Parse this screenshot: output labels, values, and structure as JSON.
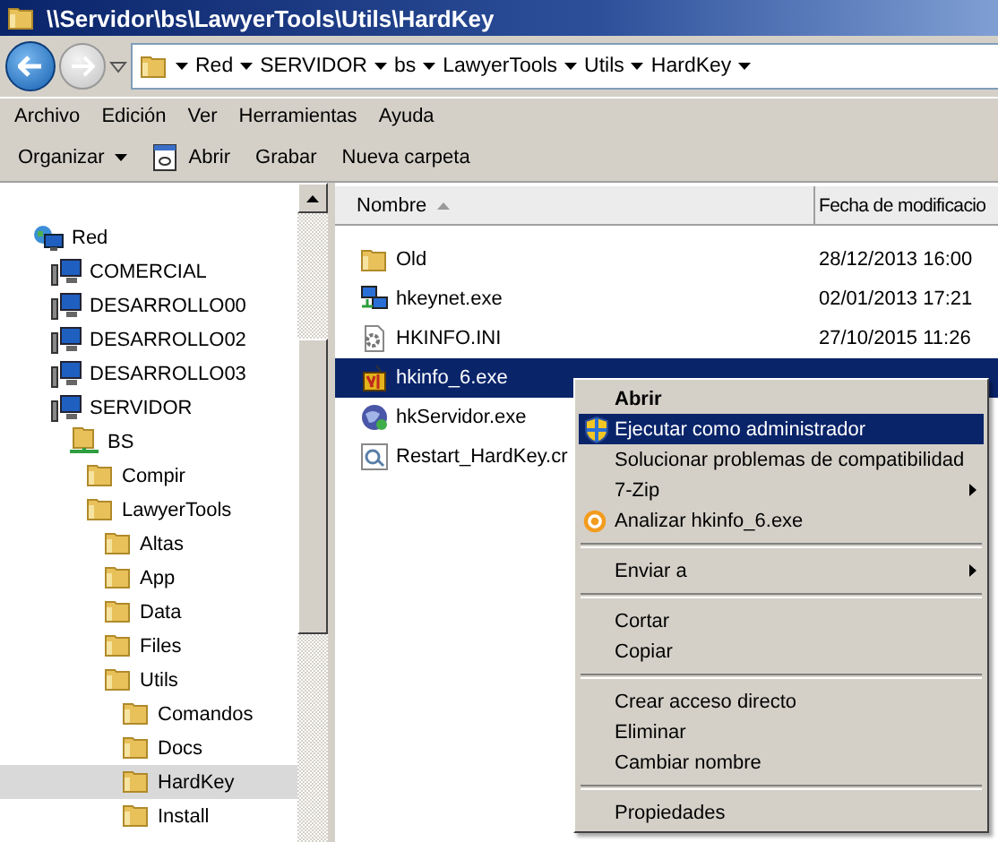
{
  "window": {
    "title": "\\\\Servidor\\bs\\LawyerTools\\Utils\\HardKey"
  },
  "breadcrumb": [
    "Red",
    "SERVIDOR",
    "bs",
    "LawyerTools",
    "Utils",
    "HardKey"
  ],
  "menu_bar": [
    "Archivo",
    "Edición",
    "Ver",
    "Herramientas",
    "Ayuda"
  ],
  "toolbar": [
    {
      "label": "Organizar",
      "kind": "dropdown"
    },
    {
      "label": "Abrir",
      "kind": "open"
    },
    {
      "label": "Grabar",
      "kind": "plain"
    },
    {
      "label": "Nueva carpeta",
      "kind": "plain"
    }
  ],
  "tree": [
    {
      "label": "Red",
      "kind": "network",
      "selected": false,
      "children": [
        {
          "label": "COMERCIAL",
          "kind": "computer",
          "selected": false
        },
        {
          "label": "DESARROLLO00",
          "kind": "computer",
          "selected": false
        },
        {
          "label": "DESARROLLO02",
          "kind": "computer",
          "selected": false
        },
        {
          "label": "DESARROLLO03",
          "kind": "computer",
          "selected": false
        },
        {
          "label": "SERVIDOR",
          "kind": "computer",
          "selected": false,
          "children": [
            {
              "label": "BS",
              "kind": "share",
              "selected": false,
              "children": [
                {
                  "label": "Compir",
                  "kind": "folder",
                  "selected": false
                },
                {
                  "label": "LawyerTools",
                  "kind": "folder",
                  "selected": false,
                  "children": [
                    {
                      "label": "Altas",
                      "kind": "folder",
                      "selected": false
                    },
                    {
                      "label": "App",
                      "kind": "folder",
                      "selected": false
                    },
                    {
                      "label": "Data",
                      "kind": "folder",
                      "selected": false
                    },
                    {
                      "label": "Files",
                      "kind": "folder",
                      "selected": false
                    },
                    {
                      "label": "Utils",
                      "kind": "folder",
                      "selected": false,
                      "children": [
                        {
                          "label": "Comandos",
                          "kind": "folder",
                          "selected": false
                        },
                        {
                          "label": "Docs",
                          "kind": "folder",
                          "selected": false
                        },
                        {
                          "label": "HardKey",
                          "kind": "folder",
                          "selected": true
                        },
                        {
                          "label": "Install",
                          "kind": "folder",
                          "selected": false
                        }
                      ]
                    }
                  ]
                }
              ]
            }
          ]
        }
      ]
    }
  ],
  "columns": [
    {
      "label": "Nombre",
      "kind": "sorted"
    },
    {
      "label": "Fecha de modificacio",
      "kind": "plain"
    }
  ],
  "files": [
    {
      "name": "Old",
      "date": "28/12/2013 16:00",
      "kind": "folder",
      "selected": false
    },
    {
      "name": "hkeynet.exe",
      "date": "02/01/2013 17:21",
      "kind": "network-app",
      "selected": false
    },
    {
      "name": "HKINFO.INI",
      "date": "27/10/2015 11:26",
      "kind": "settings-file",
      "selected": false
    },
    {
      "name": "hkinfo_6.exe",
      "kind": "program",
      "selected": true
    },
    {
      "name": "hkServidor.exe",
      "kind": "globe",
      "selected": false
    },
    {
      "name": "Restart_HardKey.cr",
      "kind": "script",
      "selected": false
    }
  ],
  "context_menu": [
    {
      "kind": "default",
      "label": "Abrir",
      "selected": false
    },
    {
      "kind": "admin",
      "label": "Ejecutar como administrador",
      "selected": true
    },
    {
      "kind": "plain",
      "label": "Solucionar problemas de compatibilidad",
      "selected": false
    },
    {
      "kind": "submenu",
      "label": "7-Zip",
      "selected": false
    },
    {
      "kind": "analyze",
      "label": "Analizar hkinfo_6.exe",
      "selected": false
    },
    {
      "kind": "separator"
    },
    {
      "kind": "submenu",
      "label": "Enviar a",
      "selected": false
    },
    {
      "kind": "separator"
    },
    {
      "kind": "plain",
      "label": "Cortar",
      "selected": false
    },
    {
      "kind": "plain",
      "label": "Copiar",
      "selected": false
    },
    {
      "kind": "separator"
    },
    {
      "kind": "plain",
      "label": "Crear acceso directo",
      "selected": false
    },
    {
      "kind": "plain",
      "label": "Eliminar",
      "selected": false
    },
    {
      "kind": "plain",
      "label": "Cambiar nombre",
      "selected": false
    },
    {
      "kind": "separator"
    },
    {
      "kind": "plain",
      "label": "Propiedades",
      "selected": false
    }
  ]
}
